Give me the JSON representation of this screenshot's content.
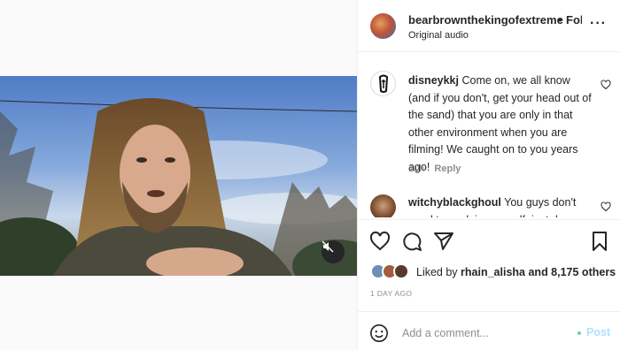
{
  "post": {
    "username": "bearbrownthekingofextreme",
    "separator": "•",
    "follow_label": "Fol",
    "audio": "Original audio",
    "more_icon": "ellipsis-icon"
  },
  "comments": [
    {
      "username": "disneykkj",
      "text": "Come on, we all know (and if you don't, get your head out of the sand) that you are only in that other environment when you are filming! We caught on to you years ago!",
      "time": "10h",
      "reply_label": "Reply"
    },
    {
      "username": "witchyblackghoul",
      "text": "You guys don't need to explain yourself, just do",
      "time": "",
      "reply_label": ""
    }
  ],
  "actions": {
    "like_icon": "heart-icon",
    "comment_icon": "comment-bubble-icon",
    "share_icon": "paper-plane-icon",
    "save_icon": "bookmark-icon"
  },
  "likes": {
    "prefix": "Liked by",
    "user": "rhain_alisha",
    "suffix": "and 8,175 others"
  },
  "timestamp": "1 DAY AGO",
  "add_comment": {
    "placeholder": "Add a comment...",
    "post_label": "Post"
  },
  "colors": {
    "accent_disabled": "#b2dffc",
    "text_primary": "#262626",
    "text_secondary": "#8e8e8e",
    "border": "#efefef"
  }
}
